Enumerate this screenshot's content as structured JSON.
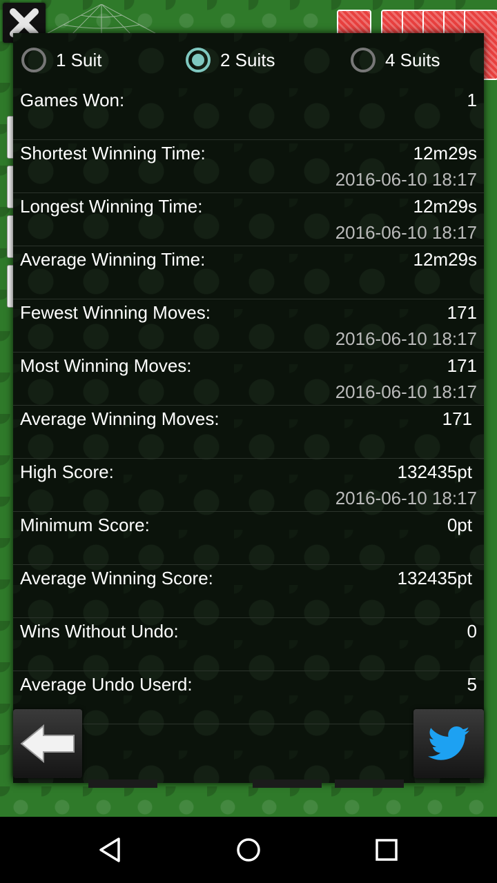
{
  "suits": [
    {
      "label": "1 Suit",
      "checked": false
    },
    {
      "label": "2 Suits",
      "checked": true
    },
    {
      "label": "4 Suits",
      "checked": false
    }
  ],
  "stats": [
    {
      "label": "Games Won:",
      "value": "1",
      "date": ""
    },
    {
      "label": "Shortest Winning Time:",
      "value": "12m29s",
      "date": "2016-06-10 18:17"
    },
    {
      "label": "Longest Winning Time:",
      "value": "12m29s",
      "date": "2016-06-10 18:17"
    },
    {
      "label": "Average Winning Time:",
      "value": "12m29s",
      "date": ""
    },
    {
      "label": "Fewest Winning Moves:",
      "value": "171",
      "date": "2016-06-10 18:17"
    },
    {
      "label": "Most Winning Moves:",
      "value": "171",
      "date": "2016-06-10 18:17"
    },
    {
      "label": "Average Winning Moves:",
      "value": "171",
      "date": ""
    },
    {
      "label": "High Score:",
      "value": "132435pt",
      "date": "2016-06-10 18:17"
    },
    {
      "label": "Minimum Score:",
      "value": "0pt",
      "date": ""
    },
    {
      "label": "Average Winning Score:",
      "value": "132435pt",
      "date": ""
    },
    {
      "label": "Wins Without Undo:",
      "value": "0",
      "date": ""
    },
    {
      "label": "Average Undo Userd:",
      "value": "5",
      "date": ""
    }
  ],
  "icons": {
    "close": "close-icon",
    "back": "back-arrow-icon",
    "twitter": "twitter-bird-icon",
    "nav_back": "nav-back-icon",
    "nav_home": "nav-home-icon",
    "nav_recents": "nav-recents-icon"
  },
  "colors": {
    "felt": "#2f7a2a",
    "panel": "#0b130b",
    "radio_checked": "#7fc8c0",
    "twitter": "#1da1f2"
  }
}
